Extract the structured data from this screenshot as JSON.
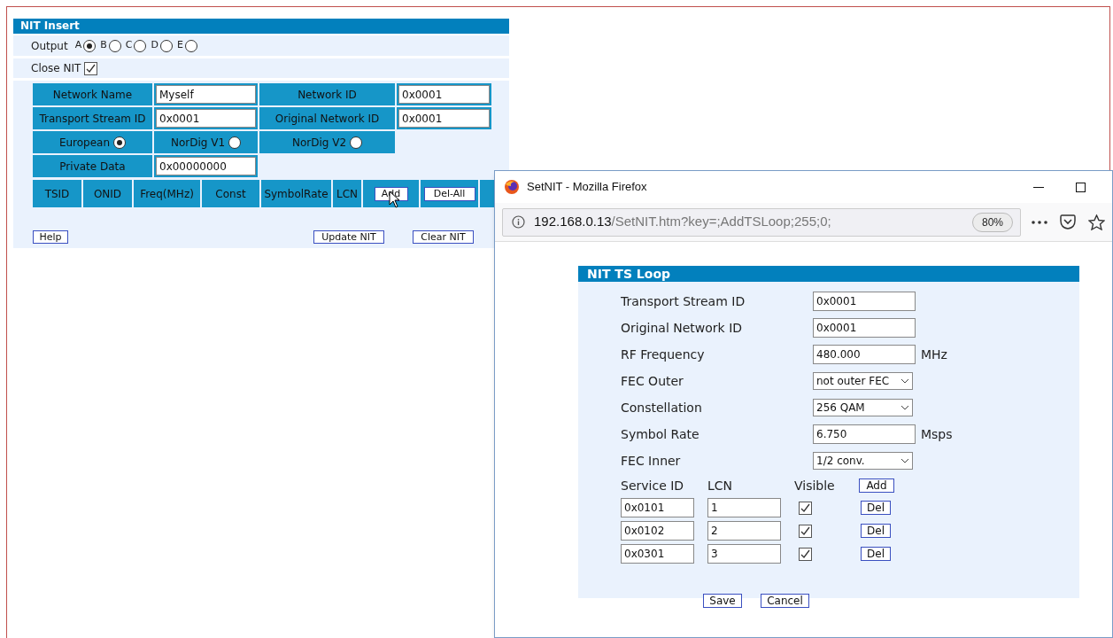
{
  "panel": {
    "title": "NIT Insert"
  },
  "output": {
    "label": "Output",
    "options": [
      {
        "label": "A",
        "selected": true
      },
      {
        "label": "B",
        "selected": false
      },
      {
        "label": "C",
        "selected": false
      },
      {
        "label": "D",
        "selected": false
      },
      {
        "label": "E",
        "selected": false
      }
    ]
  },
  "close_nit": {
    "label": "Close NIT",
    "checked": true
  },
  "network_fields": [
    {
      "label": "Network Name",
      "value": "Myself"
    },
    {
      "label": "Network ID",
      "value": "0x0001"
    },
    {
      "label": "Transport Stream ID",
      "value": "0x0001"
    },
    {
      "label": "Original Network ID",
      "value": "0x0001"
    }
  ],
  "standards": [
    {
      "label": "European",
      "selected": true
    },
    {
      "label": "NorDig V1",
      "selected": false
    },
    {
      "label": "NorDig V2",
      "selected": false
    }
  ],
  "private_data": {
    "label": "Private Data",
    "value": "0x00000000"
  },
  "loop_columns": [
    "TSID",
    "ONID",
    "Freq(MHz)",
    "Const",
    "SymbolRate",
    "LCN"
  ],
  "loop_buttons": [
    "Add",
    "Del-All"
  ],
  "buttons": [
    "Help",
    "Update NIT",
    "Clear NIT"
  ],
  "popup": {
    "title": "SetNIT - Mozilla Firefox",
    "url_host": "192.168.0.13",
    "url_path": "/SetNIT.htm?key=;AddTSLoop;255;0;",
    "zoom": "80%",
    "panel_title": "NIT TS Loop",
    "fields": [
      {
        "kind": "input",
        "label": "Transport Stream ID",
        "value": "0x0001"
      },
      {
        "kind": "input",
        "label": "Original Network ID",
        "value": "0x0001"
      },
      {
        "kind": "input",
        "label": "RF Frequency",
        "value": "480.000",
        "unit": "MHz"
      },
      {
        "kind": "select",
        "label": "FEC Outer",
        "value": "not outer FEC"
      },
      {
        "kind": "select",
        "label": "Constellation",
        "value": "256 QAM"
      },
      {
        "kind": "input",
        "label": "Symbol Rate",
        "value": "6.750",
        "unit": "Msps"
      },
      {
        "kind": "select",
        "label": "FEC Inner",
        "value": "1/2 conv."
      }
    ],
    "service_headers": [
      "Service ID",
      "LCN",
      "Visible"
    ],
    "add_button": "Add",
    "services": [
      {
        "service_id": "0x0101",
        "lcn": "1",
        "visible": true,
        "action": "Del"
      },
      {
        "service_id": "0x0102",
        "lcn": "2",
        "visible": true,
        "action": "Del"
      },
      {
        "service_id": "0x0301",
        "lcn": "3",
        "visible": true,
        "action": "Del"
      }
    ],
    "buttons": [
      "Save",
      "Cancel"
    ]
  }
}
